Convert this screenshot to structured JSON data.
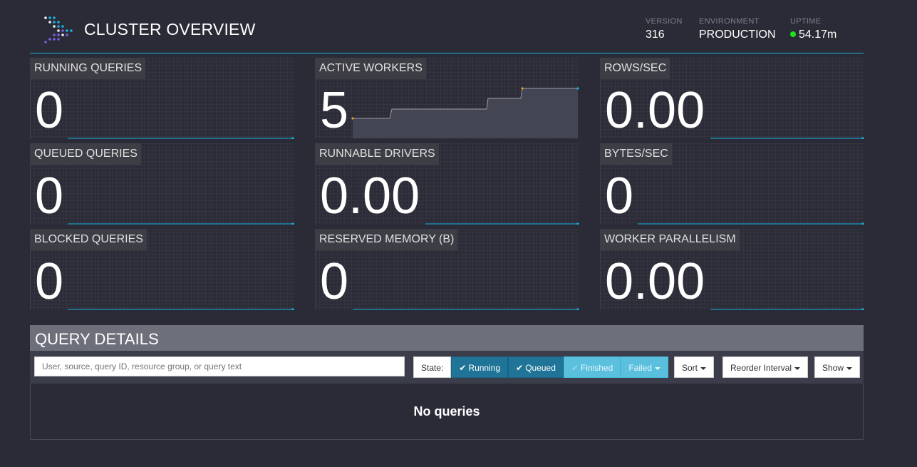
{
  "header": {
    "title": "CLUSTER OVERVIEW",
    "version_label": "VERSION",
    "version": "316",
    "environment_label": "ENVIRONMENT",
    "environment": "PRODUCTION",
    "uptime_label": "UPTIME",
    "uptime": "54.17m",
    "uptime_status_color": "#1ee11e",
    "accent_color": "#1ab2dd"
  },
  "tiles": [
    {
      "label": "RUNNING QUERIES",
      "value": "0"
    },
    {
      "label": "ACTIVE WORKERS",
      "value": "5"
    },
    {
      "label": "ROWS/SEC",
      "value": "0.00"
    },
    {
      "label": "QUEUED QUERIES",
      "value": "0"
    },
    {
      "label": "RUNNABLE DRIVERS",
      "value": "0.00"
    },
    {
      "label": "BYTES/SEC",
      "value": "0"
    },
    {
      "label": "BLOCKED QUERIES",
      "value": "0"
    },
    {
      "label": "RESERVED MEMORY (B)",
      "value": "0"
    },
    {
      "label": "WORKER PARALLELISM",
      "value": "0.00"
    }
  ],
  "query_details": {
    "title": "QUERY DETAILS",
    "search_placeholder": "User, source, query ID, resource group, or query text",
    "state_label": "State:",
    "filters": {
      "running": "Running",
      "queued": "Queued",
      "finished": "Finished",
      "failed": "Failed"
    },
    "sort_label": "Sort",
    "reorder_label": "Reorder Interval",
    "show_label": "Show",
    "empty_message": "No queries"
  }
}
